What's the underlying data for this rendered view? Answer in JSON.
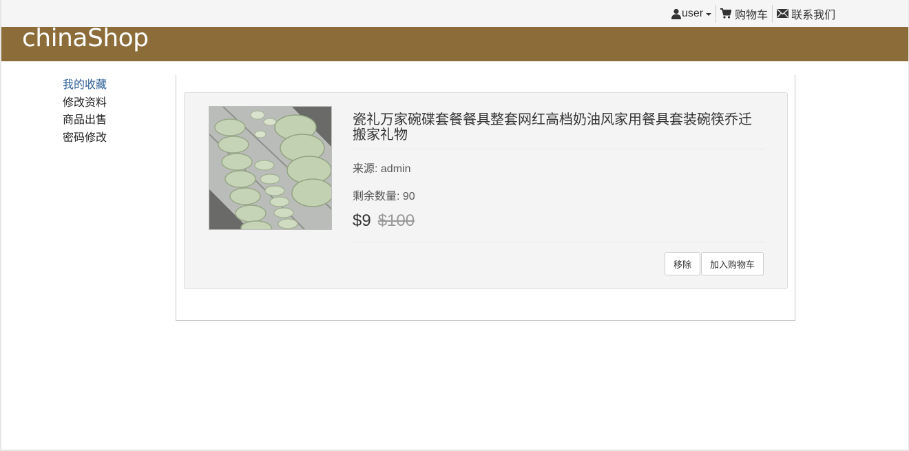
{
  "topnav": {
    "user_label": "user",
    "cart_label": "购物车",
    "contact_label": "联系我们"
  },
  "brand": {
    "name": "chinaShop"
  },
  "sidebar": {
    "items": [
      {
        "label": "我的收藏",
        "active": true
      },
      {
        "label": "修改资料",
        "active": false
      },
      {
        "label": "商品出售",
        "active": false
      },
      {
        "label": "密码修改",
        "active": false
      }
    ]
  },
  "product": {
    "title": "瓷礼万家碗碟套餐餐具整套网红高档奶油风家用餐具套装碗筷乔迁搬家礼物",
    "source_text": "来源: admin",
    "stock_text": "剩余数量: 90",
    "price_now": "$9",
    "price_old": "$100",
    "remove_label": "移除",
    "add_cart_label": "加入购物车"
  },
  "colors": {
    "brand_bar": "#8c6d3a",
    "active_link": "#2e5f97",
    "card_bg": "#f4f4f4"
  }
}
